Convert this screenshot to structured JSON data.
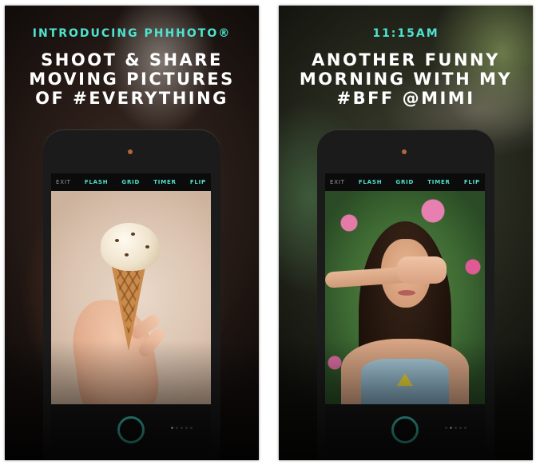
{
  "accent_color": "#4fe3cf",
  "screens": [
    {
      "kicker": "INTRODUCING PHHHOTO®",
      "headline": "SHOOT & SHARE\nMOVING PICTURES\nOF #EVERYTHING",
      "toolbar": {
        "exit": "EXIT",
        "flash": "FLASH",
        "grid": "GRID",
        "timer": "TIMER",
        "flip": "FLIP"
      },
      "photo": "ice-cream-cone-in-hand",
      "active_page": 1,
      "page_count": 5
    },
    {
      "kicker": "11:15AM",
      "headline": "ANOTHER FUNNY\nMORNING WITH MY\n#BFF @MIMI",
      "toolbar": {
        "exit": "EXIT",
        "flash": "FLASH",
        "grid": "GRID",
        "timer": "TIMER",
        "flip": "FLIP"
      },
      "photo": "woman-covering-eyes-with-hand",
      "active_page": 2,
      "page_count": 5
    }
  ]
}
